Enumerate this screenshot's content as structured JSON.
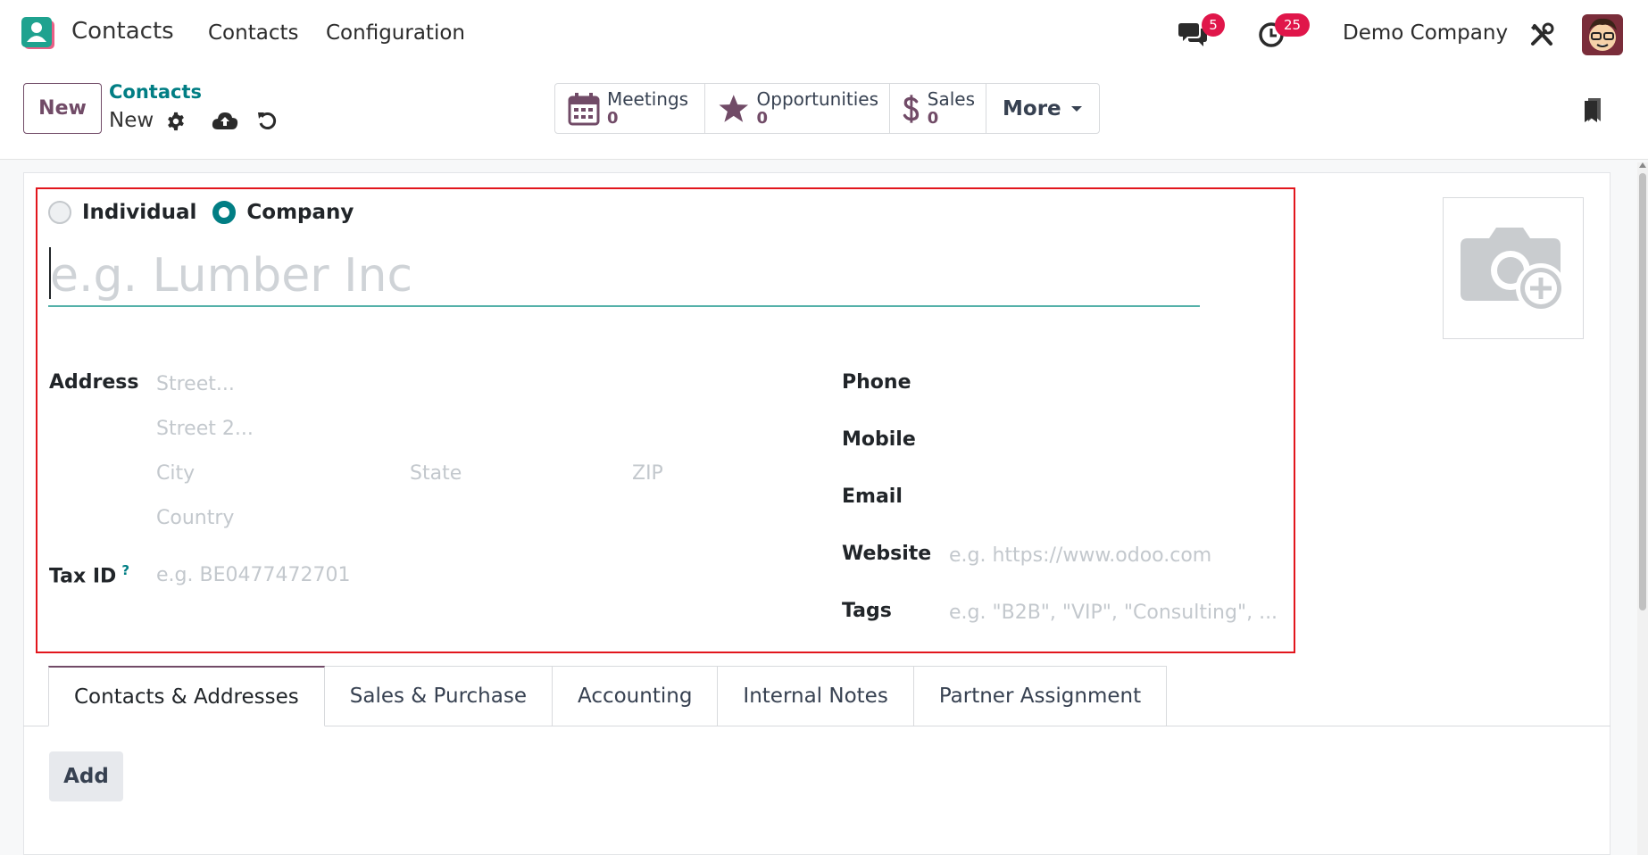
{
  "navbar": {
    "app_name": "Contacts",
    "menus": [
      "Contacts",
      "Configuration"
    ],
    "messages_badge": "5",
    "activities_badge": "25",
    "company": "Demo Company"
  },
  "control_panel": {
    "new_label": "New",
    "breadcrumb_parent": "Contacts",
    "breadcrumb_current": "New"
  },
  "smart_buttons": [
    {
      "label": "Meetings",
      "value": "0",
      "icon": "calendar-icon"
    },
    {
      "label": "Opportunities",
      "value": "0",
      "icon": "star-icon"
    },
    {
      "label": "Sales",
      "value": "0",
      "icon": "dollar-icon"
    }
  ],
  "more_label": "More",
  "form": {
    "radio_individual": "Individual",
    "radio_company": "Company",
    "selected_type": "Company",
    "name_placeholder": "e.g. Lumber Inc",
    "address_label": "Address",
    "street_placeholder": "Street...",
    "street2_placeholder": "Street 2...",
    "city_placeholder": "City",
    "state_placeholder": "State",
    "zip_placeholder": "ZIP",
    "country_placeholder": "Country",
    "taxid_label": "Tax ID",
    "taxid_help": "?",
    "taxid_placeholder": "e.g. BE0477472701",
    "phone_label": "Phone",
    "mobile_label": "Mobile",
    "email_label": "Email",
    "website_label": "Website",
    "website_placeholder": "e.g. https://www.odoo.com",
    "tags_label": "Tags",
    "tags_placeholder": "e.g. \"B2B\", \"VIP\", \"Consulting\", ..."
  },
  "tabs": [
    "Contacts & Addresses",
    "Sales & Purchase",
    "Accounting",
    "Internal Notes",
    "Partner Assignment"
  ],
  "add_label": "Add",
  "colors": {
    "brand": "#714b67",
    "accent": "#017e84",
    "badge": "#e0164a",
    "highlight": "#e2161d"
  }
}
